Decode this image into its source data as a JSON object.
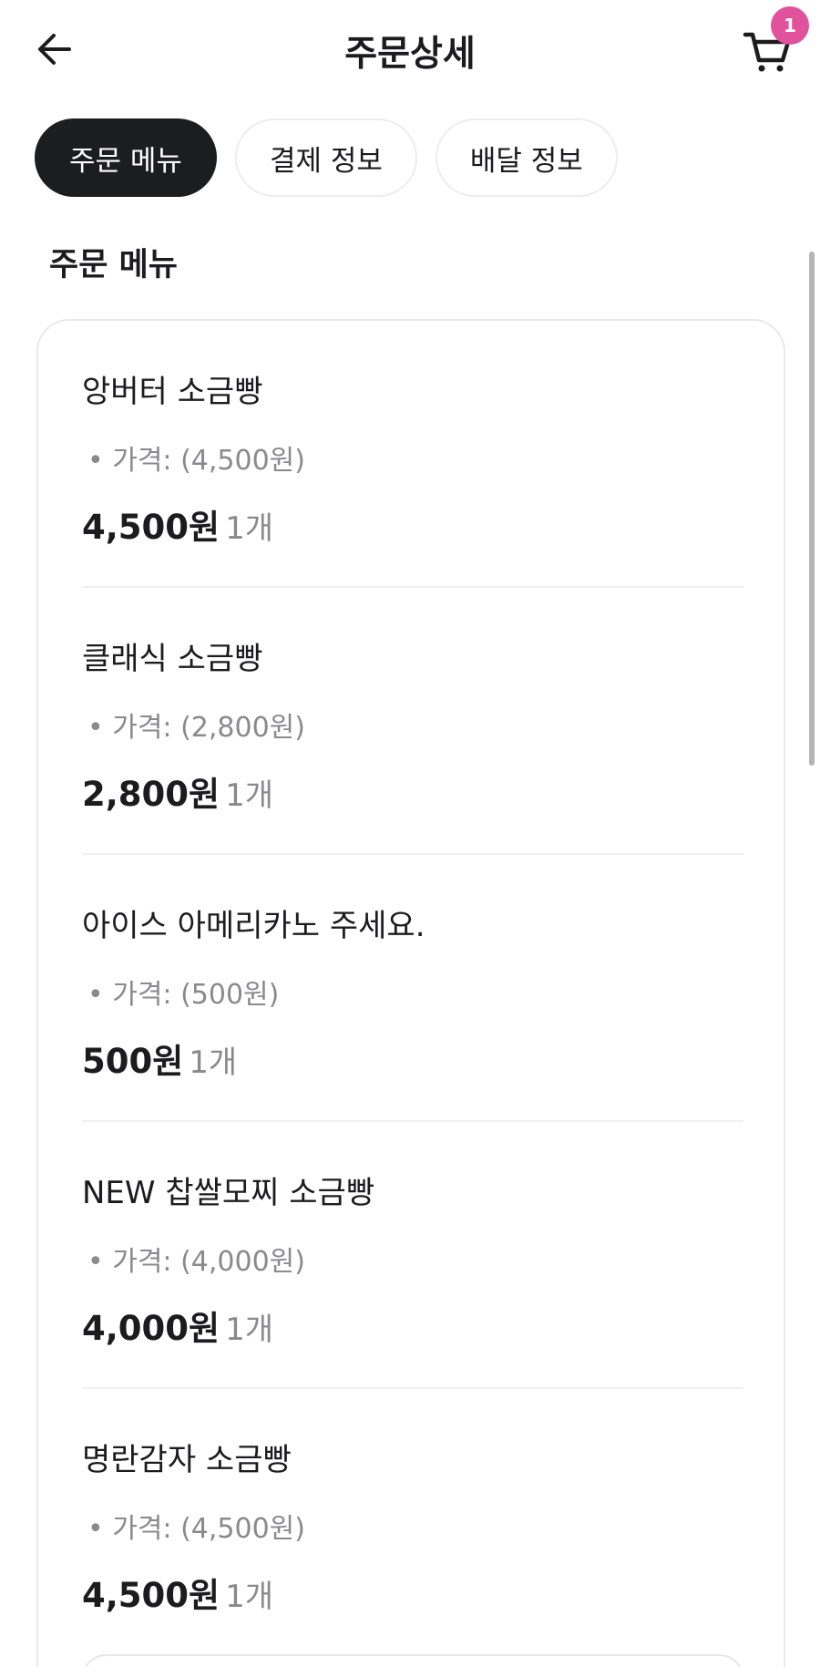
{
  "header": {
    "title": "주문상세",
    "cart_badge_count": "1",
    "back_icon": "arrow-left-icon",
    "cart_icon": "shopping-cart-icon",
    "badge_color": "#e2519b"
  },
  "tabs": [
    {
      "label": "주문 메뉴",
      "active": true
    },
    {
      "label": "결제 정보",
      "active": false
    },
    {
      "label": "배달 정보",
      "active": false
    }
  ],
  "section": {
    "title": "주문 메뉴"
  },
  "items": [
    {
      "name": "앙버터 소금빵",
      "price_line": "• 가격: (4,500원)",
      "amount": "4,500원",
      "qty": "1개"
    },
    {
      "name": "클래식 소금빵",
      "price_line": "• 가격: (2,800원)",
      "amount": "2,800원",
      "qty": "1개"
    },
    {
      "name": "아이스 아메리카노 주세요.",
      "price_line": "• 가격: (500원)",
      "amount": "500원",
      "qty": "1개"
    },
    {
      "name": "NEW 찹쌀모찌 소금빵",
      "price_line": "• 가격: (4,000원)",
      "amount": "4,000원",
      "qty": "1개"
    },
    {
      "name": "명란감자 소금빵",
      "price_line": "• 가격: (4,500원)",
      "amount": "4,500원",
      "qty": "1개"
    }
  ]
}
